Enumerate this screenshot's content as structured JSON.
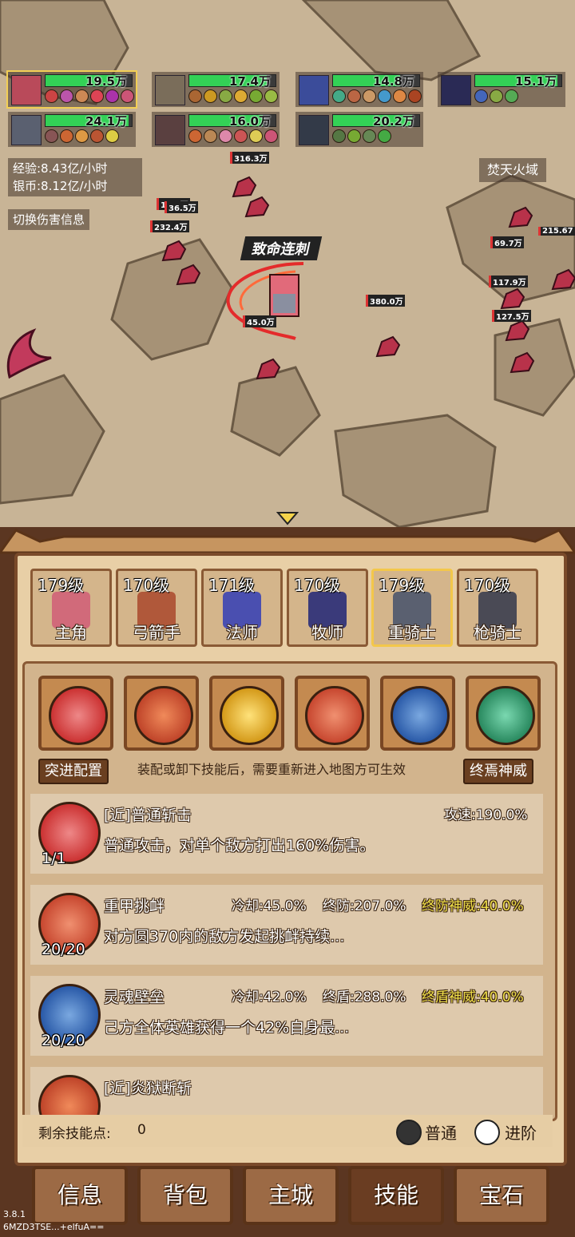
{
  "heroes_hp": [
    {
      "hp": "19.5万",
      "selected": true
    },
    {
      "hp": "17.4万"
    },
    {
      "hp": "14.8万"
    },
    {
      "hp": "15.1万"
    },
    {
      "hp": "24.1万"
    },
    {
      "hp": "16.0万"
    },
    {
      "hp": "20.2万"
    }
  ],
  "stats": {
    "exp": "经验:8.43亿/小时",
    "silver": "银币:8.12亿/小时"
  },
  "toggle_damage_label": "切换伤害信息",
  "zone_name": "焚天火域",
  "skill_callout": "致命连刺",
  "damage_numbers": [
    "316.3万",
    "17.8万",
    "36.5万",
    "232.4万",
    "69.7万",
    "215.67",
    "117.9万",
    "127.5万",
    "380.0万",
    "45.0万"
  ],
  "hero_tabs": [
    {
      "level": "179级",
      "name": "主角"
    },
    {
      "level": "170级",
      "name": "弓箭手"
    },
    {
      "level": "171级",
      "name": "法师"
    },
    {
      "level": "170级",
      "name": "牧师"
    },
    {
      "level": "179级",
      "name": "重骑士",
      "selected": true
    },
    {
      "level": "170级",
      "name": "枪骑士"
    }
  ],
  "skill_slots": [
    "slash-icon",
    "sword-icon",
    "golden-shield-icon",
    "fist-icon",
    "round-shield-icon",
    "banner-icon"
  ],
  "config": {
    "left_label": "突进配置",
    "hint": "装配或卸下技能后，需要重新进入地图方可生效",
    "right_label": "终焉神威"
  },
  "skills": [
    {
      "name": "[近]普通斩击",
      "count": "1/1",
      "desc": "普通攻击，对单个敌方打出160%伤害。",
      "stats": [
        "攻速:190.0%"
      ]
    },
    {
      "name": "重甲挑衅",
      "count": "20/20",
      "desc": "对方圆370内的敌方发起挑衅持续...",
      "stats": [
        "冷却:45.0%",
        "终防:207.0%",
        "终防神威:40.0%"
      ]
    },
    {
      "name": "灵魂壁垒",
      "count": "20/20",
      "desc": "己方全体英雄获得一个42%自身最...",
      "stats": [
        "冷却:42.0%",
        "终盾:288.0%",
        "终盾神威:40.0%"
      ]
    },
    {
      "name": "[近]炎狱断斩",
      "count": "",
      "desc": "",
      "stats": []
    }
  ],
  "remaining_points": {
    "label": "剩余技能点:",
    "value": "0"
  },
  "mode": {
    "normal": "普通",
    "advanced": "进阶",
    "selected": "normal"
  },
  "nav": [
    {
      "label": "信息"
    },
    {
      "label": "背包"
    },
    {
      "label": "主城"
    },
    {
      "label": "技能",
      "selected": true
    },
    {
      "label": "宝石"
    }
  ],
  "version": {
    "number": "3.8.1",
    "code": "6MZD3TSE...+elfuA=="
  },
  "colors": {
    "hp_green": "#33d156",
    "highlight_gold": "#f0e04a",
    "panel_brown": "#5b3621",
    "selected_frame": "#f3c74a"
  }
}
